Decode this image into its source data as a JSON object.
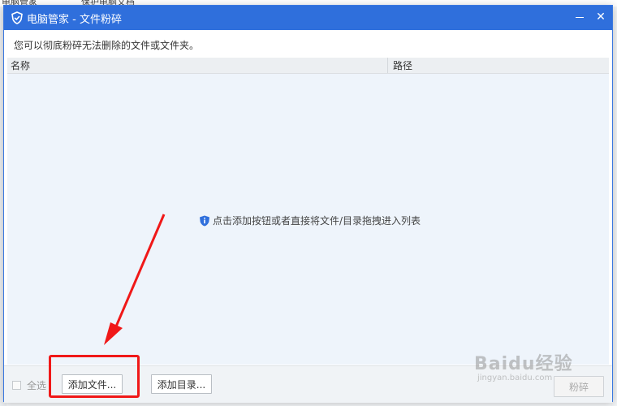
{
  "background": {
    "fragments": [
      "电脑管家",
      "保护电脑文档"
    ]
  },
  "dialog": {
    "title": "电脑管家 - 文件粉碎",
    "description": "您可以彻底粉碎无法删除的文件或文件夹。",
    "columns": {
      "name": "名称",
      "path": "路径"
    },
    "empty_hint": "点击添加按钮或者直接将文件/目录拖拽进入列表",
    "footer": {
      "select_all": "全选",
      "add_file": "添加文件...",
      "add_dir": "添加目录...",
      "shred": "粉碎"
    }
  },
  "watermark": {
    "main": "Baidu经验",
    "sub": "jingyan.baidu.com"
  },
  "colors": {
    "titlebar": "#2f6fdc",
    "annotation": "#f01818",
    "list_bg": "#eef4fb"
  }
}
